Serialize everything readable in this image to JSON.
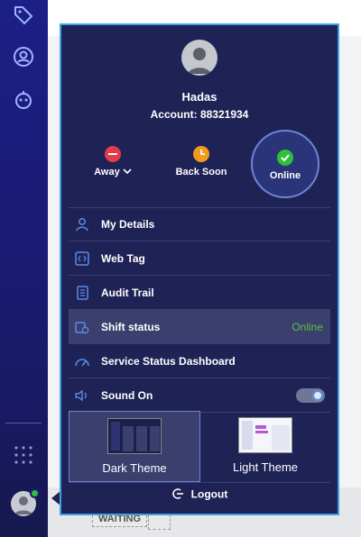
{
  "user": {
    "name": "Hadas",
    "account": "Account: 88321934"
  },
  "statuses": [
    {
      "label": "Away",
      "color": "#e23b4b"
    },
    {
      "label": "Back Soon",
      "color": "#f29a1b"
    },
    {
      "label": "Online",
      "color": "#2fbf3a"
    }
  ],
  "menu": {
    "my_details": "My Details",
    "web_tag": "Web Tag",
    "audit_trail": "Audit Trail",
    "shift_status": "Shift status",
    "shift_status_value": "Online",
    "service_status": "Service Status Dashboard",
    "sound": "Sound On"
  },
  "themes": {
    "dark": "Dark Theme",
    "light": "Light Theme"
  },
  "logout": "Logout",
  "background": {
    "waiting": "WAITING"
  },
  "colors": {
    "panel": "#1f2255",
    "accent": "#3fa1e0",
    "online": "#53c144"
  }
}
